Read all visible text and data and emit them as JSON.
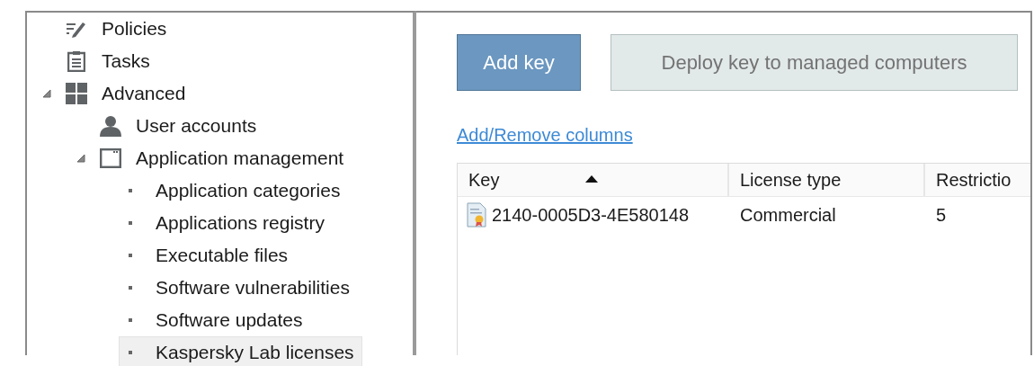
{
  "tree": [
    {
      "label": "Policies",
      "selected": false
    },
    {
      "label": "Tasks",
      "selected": false
    },
    {
      "label": "Advanced",
      "selected": false,
      "expanded": true,
      "children": [
        {
          "label": "User accounts",
          "selected": false
        },
        {
          "label": "Application management",
          "selected": false,
          "expanded": true,
          "children": [
            {
              "label": "Application categories",
              "selected": false
            },
            {
              "label": "Applications registry",
              "selected": false
            },
            {
              "label": "Executable files",
              "selected": false
            },
            {
              "label": "Software vulnerabilities",
              "selected": false
            },
            {
              "label": "Software updates",
              "selected": false
            },
            {
              "label": "Kaspersky Lab licenses",
              "selected": true
            }
          ]
        }
      ]
    }
  ],
  "buttons": [
    {
      "label": "Add key",
      "disabled": false
    },
    {
      "label": "Deploy key to managed computers",
      "disabled": true
    }
  ],
  "columns_link": "Add/Remove columns",
  "table": {
    "columns": [
      {
        "label": "Key",
        "sorted": true
      },
      {
        "label": "License type",
        "sorted": false
      },
      {
        "label": "Restrictio",
        "sorted": false
      }
    ],
    "rows": [
      [
        "2140-0005D3-4E580148",
        "Commercial",
        "5"
      ]
    ]
  }
}
